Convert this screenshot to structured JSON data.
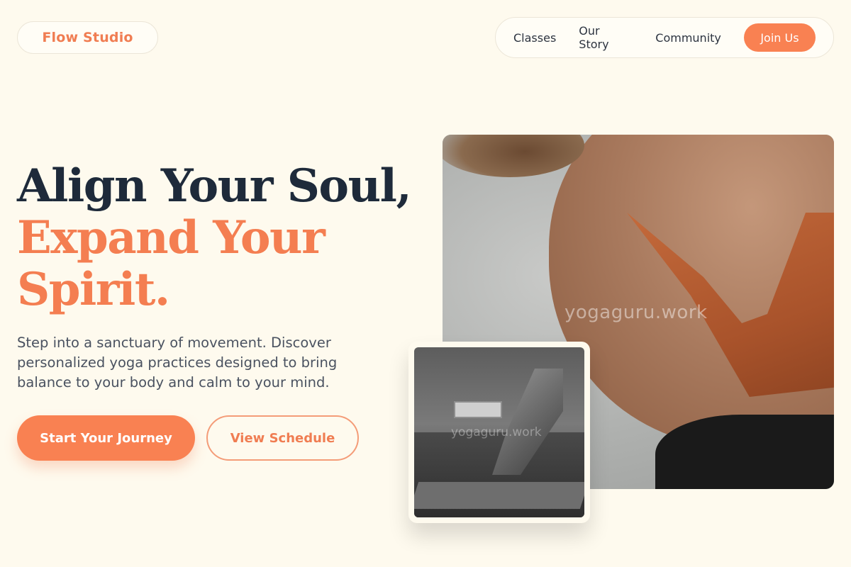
{
  "brand": {
    "name": "Flow Studio"
  },
  "nav": {
    "links": [
      "Classes",
      "Our Story",
      "Community"
    ],
    "cta": "Join Us"
  },
  "hero": {
    "title_line1": "Align Your Soul,",
    "title_line2": "Expand Your",
    "title_line3": "Spirit.",
    "subtitle": "Step into a sanctuary of movement. Discover personalized yoga practices designed to bring balance to your body and calm to your mind.",
    "primary_cta": "Start Your Journey",
    "secondary_cta": "View Schedule"
  },
  "images": {
    "main_watermark": "yogaguru.work",
    "inset_watermark": "yogaguru.work"
  },
  "colors": {
    "background": "#fefaee",
    "accent": "#f98152",
    "heading": "#1e2a3a"
  }
}
